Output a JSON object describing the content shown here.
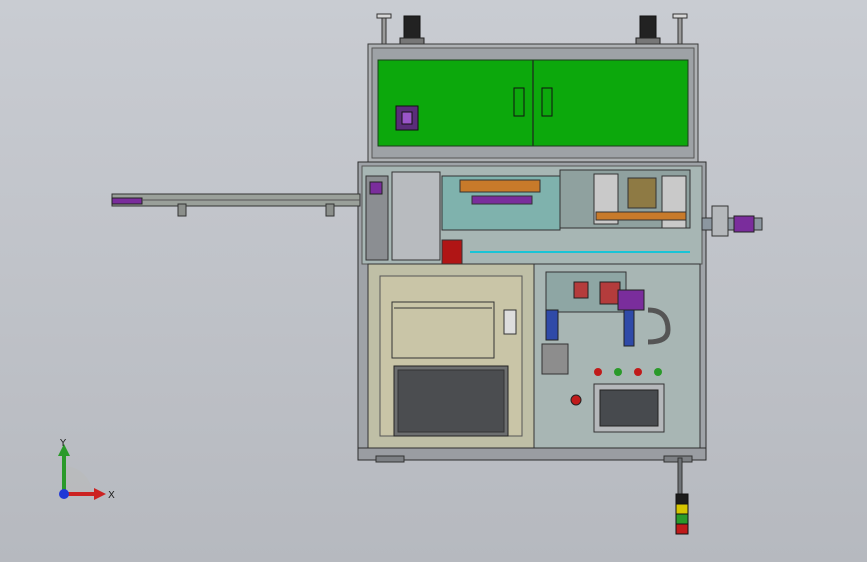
{
  "triad": {
    "x_label": "X",
    "y_label": "Y"
  },
  "colors": {
    "background": "#c3c6cc",
    "frame": "#8c8f94",
    "green_panel": "#0ca80c",
    "cabinet": "#c9c5a7",
    "interior": "#a7b6b4",
    "accent_purple": "#7a2d9c",
    "accent_red": "#b01515",
    "accent_orange": "#c87a2a",
    "accent_cyan": "#18c4d6"
  },
  "signal_tower": [
    "#1c1c1c",
    "#d6c600",
    "#2a9a2a",
    "#c01a1a"
  ]
}
